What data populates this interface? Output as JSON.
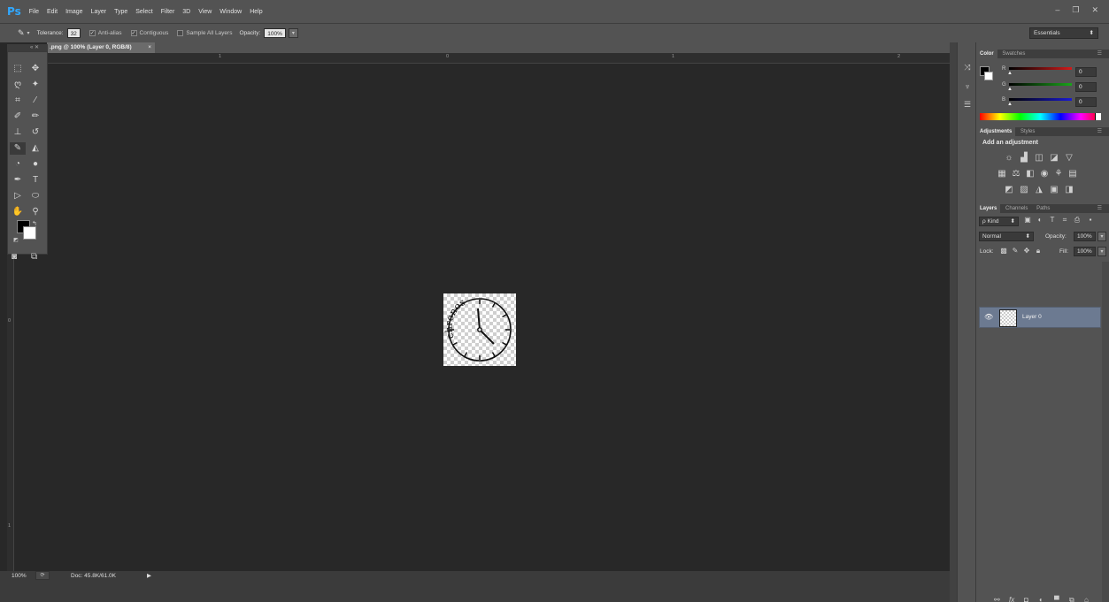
{
  "app": {
    "logo": "Ps",
    "menu": [
      "File",
      "Edit",
      "Image",
      "Layer",
      "Type",
      "Select",
      "Filter",
      "3D",
      "View",
      "Window",
      "Help"
    ],
    "window_controls": [
      "–",
      "❐",
      "✕"
    ]
  },
  "options_bar": {
    "tool_icon": "background-eraser-icon",
    "tool_dropdown": "▾",
    "tolerance_label": "Tolerance:",
    "tolerance_value": "32",
    "anti_alias_check": "✓",
    "anti_alias_label": "Anti-alias",
    "contiguous_check": "✓",
    "contiguous_label": "Contiguous",
    "sample_all_label": "Sample All Layers",
    "opacity_label": "Opacity:",
    "opacity_value": "100%",
    "opacity_dropdown": "▾",
    "workspace": "Essentials",
    "workspace_arrow": "⬍"
  },
  "document": {
    "tab_title": ".png @ 100% (Layer 0, RGB/8)",
    "tab_close": "×",
    "image_text": "chronos",
    "tools_header": "« ✕"
  },
  "rulers": {
    "h_ticks": [
      "1",
      "0",
      "1",
      "2"
    ],
    "v_ticks": [
      "0",
      "1"
    ]
  },
  "status": {
    "zoom": "100%",
    "doc": "Doc: 45.8K/61.0K",
    "arrow": "▶"
  },
  "color_panel": {
    "tabs": [
      "Color",
      "Swatches"
    ],
    "r_label": "R",
    "g_label": "G",
    "b_label": "B",
    "r_value": "0",
    "g_value": "0",
    "b_value": "0",
    "slider_colors": {
      "r": "#d21a1a",
      "g": "#1aa51a",
      "b": "#1a1ad2"
    }
  },
  "adjustments_panel": {
    "tabs": [
      "Adjustments",
      "Styles"
    ],
    "heading": "Add an adjustment"
  },
  "layers_panel": {
    "tabs": [
      "Layers",
      "Channels",
      "Paths"
    ],
    "filter_kind": "ρ Kind",
    "kind_arrow": "⬍",
    "blend_mode": "Normal",
    "blend_arrow": "⬍",
    "opacity_label": "Opacity:",
    "opacity_value": "100%",
    "lock_label": "Lock:",
    "fill_label": "Fill:",
    "fill_value": "100%",
    "layers": [
      {
        "name": "Layer 0",
        "visible": true
      }
    ]
  },
  "accent_color": "#31a8ff",
  "selected_layer_color": "#6c7a91"
}
